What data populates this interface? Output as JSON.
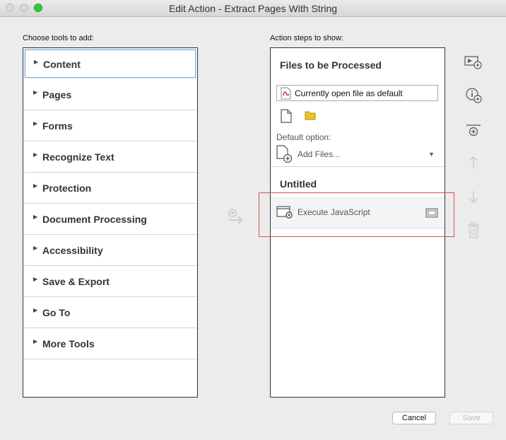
{
  "window": {
    "title": "Edit Action - Extract Pages With String"
  },
  "left": {
    "heading": "Choose tools to add:",
    "categories": [
      "Content",
      "Pages",
      "Forms",
      "Recognize Text",
      "Protection",
      "Document Processing",
      "Accessibility",
      "Save & Export",
      "Go To",
      "More Tools"
    ]
  },
  "right": {
    "heading": "Action steps to show:",
    "files_header": "Files to be Processed",
    "file_field": "Currently open file as default",
    "default_option_label": "Default option:",
    "add_files": "Add Files...",
    "group_title": "Untitled",
    "step_label": "Execute JavaScript"
  },
  "buttons": {
    "cancel": "Cancel",
    "save": "Save"
  },
  "colors": {
    "accent": "#2fc840",
    "highlight": "#d9534f",
    "pdf_red": "#d32f2f",
    "folder": "#f0c419"
  }
}
